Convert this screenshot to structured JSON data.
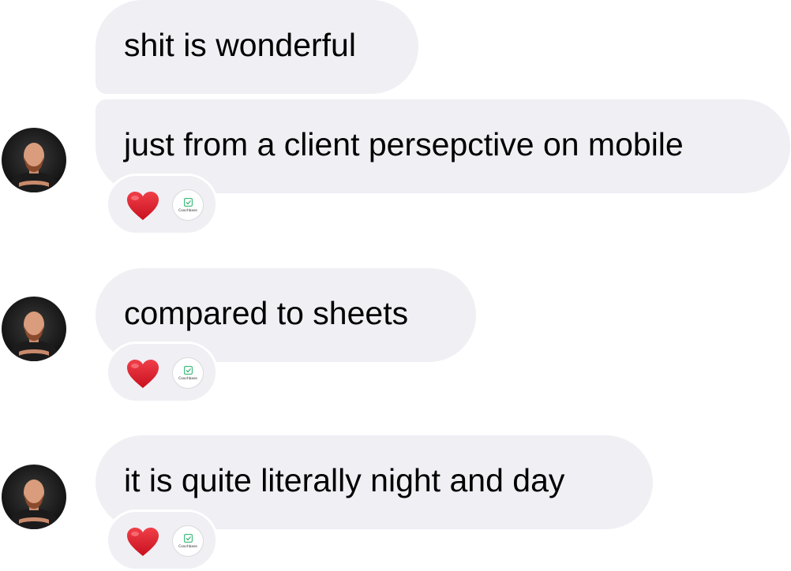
{
  "messages": [
    {
      "text": "shit is wonderful"
    },
    {
      "text": "just from a client persepctive on mobile",
      "reactions": [
        "heart-emoji",
        "Coachbase"
      ]
    },
    {
      "text": "compared to sheets",
      "reactions": [
        "heart-emoji",
        "Coachbase"
      ]
    },
    {
      "text": "it is quite literally night and day",
      "reactions": [
        "heart-emoji",
        "Coachbase"
      ]
    }
  ],
  "reaction_app_name": "Coachbase",
  "colors": {
    "bubble_bg": "#efeff4",
    "heart": "#e0202e",
    "app_logo": "#3cb878",
    "background": "#ffffff"
  },
  "icons": {
    "heart": "heart-emoji",
    "app": "coachbase-logo-icon",
    "avatar": "sender-avatar"
  }
}
